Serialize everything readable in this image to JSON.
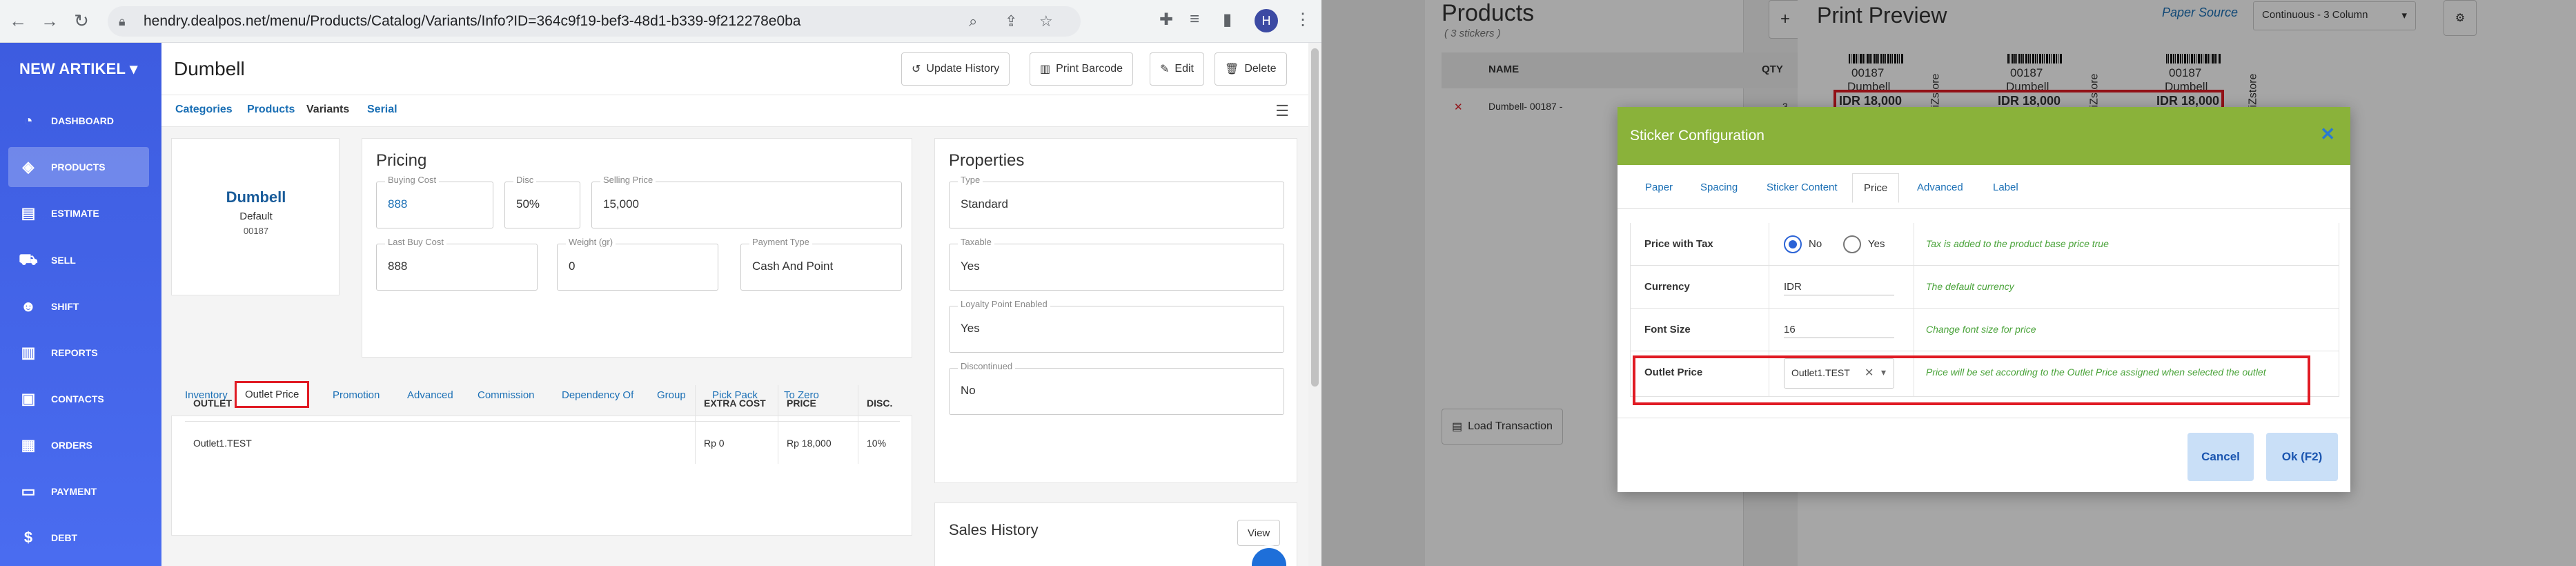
{
  "browser": {
    "url": "hendry.dealpos.net/menu/Products/Catalog/Variants/Info?ID=364c9f19-bef3-48d1-b339-9f212278e0ba",
    "avatar": "H",
    "icons": [
      "back-icon",
      "forward-icon",
      "reload-icon",
      "lock-icon",
      "zoom-icon",
      "share-icon",
      "star-icon",
      "extensions-icon",
      "media-icon",
      "sidepanel-icon",
      "menu-icon"
    ]
  },
  "sidebar": {
    "brand": "NEW ARTIKEL ▾",
    "items": [
      {
        "label": "DASHBOARD",
        "icon": "dashboard-icon",
        "glyph": "◔"
      },
      {
        "label": "PRODUCTS",
        "icon": "tag-icon",
        "glyph": "◈"
      },
      {
        "label": "ESTIMATE",
        "icon": "clipboard-icon",
        "glyph": "▤"
      },
      {
        "label": "SELL",
        "icon": "cart-icon",
        "glyph": "⛟"
      },
      {
        "label": "SHIFT",
        "icon": "users-icon",
        "glyph": "☻"
      },
      {
        "label": "REPORTS",
        "icon": "chart-icon",
        "glyph": "▥"
      },
      {
        "label": "CONTACTS",
        "icon": "contact-icon",
        "glyph": "▣"
      },
      {
        "label": "ORDERS",
        "icon": "orders-icon",
        "glyph": "▦"
      },
      {
        "label": "PAYMENT",
        "icon": "money-icon",
        "glyph": "▭"
      },
      {
        "label": "DEBT",
        "icon": "dollar-icon",
        "glyph": "$"
      }
    ]
  },
  "header": {
    "title": "Dumbell",
    "buttons": {
      "update_history": "Update History",
      "print_barcode": "Print Barcode",
      "edit": "Edit",
      "delete": "Delete"
    }
  },
  "tabs": [
    "Categories",
    "Products",
    "Variants",
    "Serial"
  ],
  "product": {
    "name": "Dumbell",
    "variant": "Default",
    "code": "00187"
  },
  "pricing": {
    "title": "Pricing",
    "buying_cost": {
      "label": "Buying Cost",
      "value": "888"
    },
    "disc": {
      "label": "Disc",
      "value": "50%"
    },
    "selling_price": {
      "label": "Selling Price",
      "value": "15,000"
    },
    "last_buy_cost": {
      "label": "Last Buy Cost",
      "value": "888"
    },
    "weight": {
      "label": "Weight (gr)",
      "value": "0"
    },
    "payment_type": {
      "label": "Payment Type",
      "value": "Cash And Point"
    }
  },
  "properties": {
    "title": "Properties",
    "type": {
      "label": "Type",
      "value": "Standard"
    },
    "taxable": {
      "label": "Taxable",
      "value": "Yes"
    },
    "loyalty": {
      "label": "Loyalty Point Enabled",
      "value": "Yes"
    },
    "discontinued": {
      "label": "Discontinued",
      "value": "No"
    }
  },
  "inner_tabs": [
    "Inventory",
    "Outlet Price",
    "Promotion",
    "Advanced",
    "Commission",
    "Dependency Of",
    "Group",
    "Pick Pack",
    "To Zero"
  ],
  "outlet_table": {
    "headers": [
      "OUTLET",
      "EXTRA COST",
      "PRICE",
      "DISC."
    ],
    "rows": [
      [
        "Outlet1.TEST",
        "Rp 0",
        "Rp 18,000",
        "10%"
      ]
    ]
  },
  "sales_history": {
    "title": "Sales History",
    "button": "View"
  },
  "right": {
    "products_title": "Products",
    "products_sub": "( 3 stickers )",
    "col_name": "NAME",
    "col_qty": "QTY",
    "row_name": "Dumbell- 00187 -",
    "row_qty": "3",
    "load_transaction": "Load Transaction",
    "print_preview": "Print Preview",
    "paper_source_label": "Paper Source",
    "paper_source_value": "Continuous - 3 Column",
    "sticker": {
      "code": "00187",
      "name": "Dumbell",
      "price": "IDR 18,000",
      "store": "iZstore"
    }
  },
  "modal": {
    "title": "Sticker Configuration",
    "tabs": [
      "Paper",
      "Spacing",
      "Sticker Content",
      "Price",
      "Advanced",
      "Label"
    ],
    "rows": {
      "price_with_tax": {
        "label": "Price with Tax",
        "no": "No",
        "yes": "Yes",
        "hint": "Tax is added to the product base price true"
      },
      "currency": {
        "label": "Currency",
        "value": "IDR",
        "hint": "The default currency"
      },
      "font_size": {
        "label": "Font Size",
        "value": "16",
        "hint": "Change font size for price"
      },
      "outlet_price": {
        "label": "Outlet Price",
        "value": "Outlet1.TEST",
        "hint": "Price will be set according to the Outlet Price assigned when selected the outlet"
      }
    },
    "cancel": "Cancel",
    "ok": "Ok (F2)"
  },
  "colors": {
    "sidebar": "#4a6cf0",
    "accent_green": "#8ab23a",
    "highlight_red": "#e01b24",
    "link_blue": "#1a6fb5"
  }
}
